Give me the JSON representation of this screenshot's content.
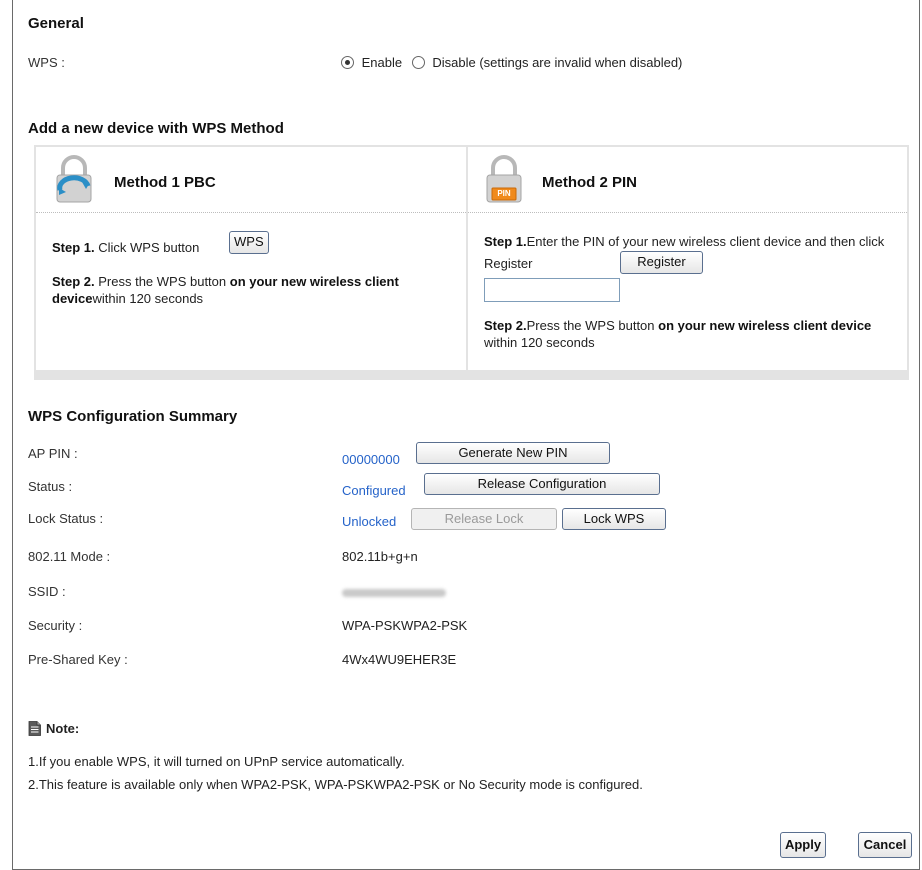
{
  "general": {
    "title": "General",
    "wps_label": "WPS :",
    "enable_label": "Enable",
    "disable_label": "Disable (settings are invalid when disabled)"
  },
  "add_device": {
    "title": "Add a new device with WPS Method",
    "method1": {
      "title": "Method 1 PBC",
      "step1_prefix": "Step 1.",
      "step1_text": " Click WPS button",
      "wps_button": "WPS",
      "step2_prefix": "Step 2.",
      "step2_text": " Press the WPS button ",
      "step2_bold": "on your new wireless client device",
      "step2_suffix": "within 120 seconds"
    },
    "method2": {
      "title": "Method 2 PIN",
      "icon_label": "PIN",
      "step1_prefix": "Step 1.",
      "step1_text": "Enter the PIN of your new wireless client device and then click Register",
      "register_button": "Register",
      "pin_value": "",
      "step2_prefix": "Step 2.",
      "step2_text": "Press the WPS button ",
      "step2_bold": "on your new wireless client device",
      "step2_suffix": " within 120 seconds"
    }
  },
  "summary": {
    "title": "WPS Configuration Summary",
    "ap_pin_label": "AP PIN :",
    "ap_pin_value": "00000000",
    "generate_button": "Generate New PIN",
    "status_label": "Status :",
    "status_value": "Configured",
    "release_config_button": "Release Configuration",
    "lock_status_label": "Lock Status :",
    "lock_status_value": "Unlocked",
    "release_lock_button": "Release Lock",
    "lock_wps_button": "Lock WPS",
    "mode_label": "802.11 Mode :",
    "mode_value": "802.11b+g+n",
    "ssid_label": "SSID :",
    "security_label": "Security :",
    "security_value": "WPA-PSKWPA2-PSK",
    "psk_label": "Pre-Shared Key :",
    "psk_value": "4Wx4WU9EHER3E"
  },
  "note": {
    "title": "Note:",
    "line1": "1.If you enable WPS, it will turned on UPnP service automatically.",
    "line2": "2.This feature is available only when WPA2-PSK, WPA-PSKWPA2-PSK or No Security mode is configured."
  },
  "actions": {
    "apply": "Apply",
    "cancel": "Cancel"
  },
  "colors": {
    "link_blue": "#2563c9",
    "button_border": "#5a6f8f",
    "panel_bg": "#e3e3e3"
  }
}
